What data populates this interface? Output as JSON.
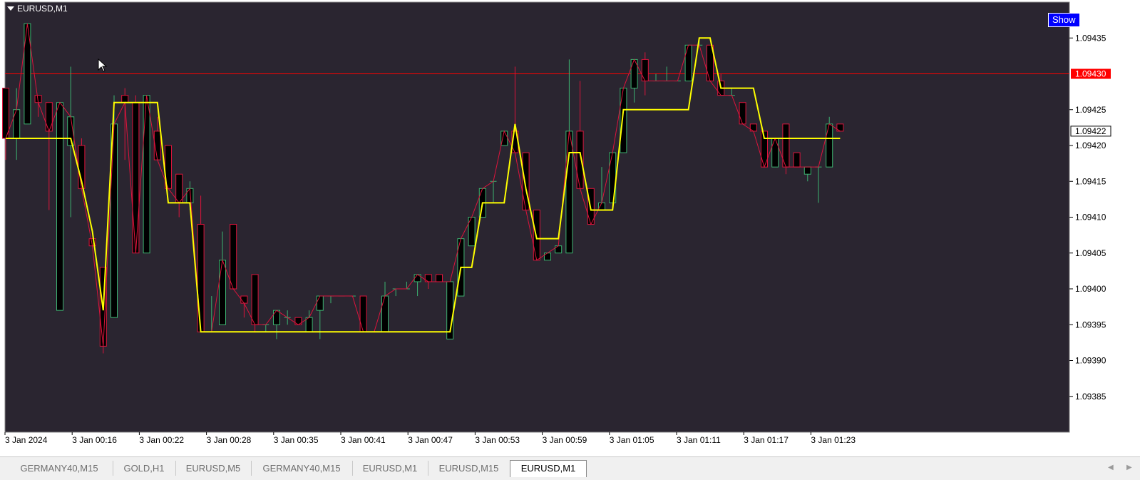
{
  "chart": {
    "symbol": "EURUSD,M1",
    "show_button": "Show",
    "current_price": "1.09422",
    "line_price": "1.09430",
    "price_ticks": [
      "1.09435",
      "1.09425",
      "1.09420",
      "1.09415",
      "1.09410",
      "1.09405",
      "1.09400",
      "1.09395",
      "1.09390",
      "1.09385"
    ],
    "time_ticks": [
      "3 Jan 2024",
      "3 Jan 00:16",
      "3 Jan 00:22",
      "3 Jan 00:28",
      "3 Jan 00:35",
      "3 Jan 00:41",
      "3 Jan 00:47",
      "3 Jan 00:53",
      "3 Jan 00:59",
      "3 Jan 01:05",
      "3 Jan 01:11",
      "3 Jan 01:17",
      "3 Jan 01:23"
    ],
    "colors": {
      "background": "#2a2530",
      "bull": "#3cb371",
      "bear": "#dc143c",
      "yellow": "#ffff00",
      "price_line": "#ff0000",
      "axis_text": "#ffffff"
    },
    "candles": [
      [
        1.09428,
        1.09428,
        1.09418,
        1.09421
      ],
      [
        1.09421,
        1.09428,
        1.09418,
        1.09425
      ],
      [
        1.09423,
        1.09437,
        1.09423,
        1.09437
      ],
      [
        1.09427,
        1.09427,
        1.09424,
        1.09426
      ],
      [
        1.09426,
        1.09426,
        1.09411,
        1.09422
      ],
      [
        1.09397,
        1.09426,
        1.09397,
        1.09426
      ],
      [
        1.0942,
        1.09431,
        1.0941,
        1.09424
      ],
      [
        1.0942,
        1.09421,
        1.09414,
        1.09414
      ],
      [
        1.09407,
        1.09407,
        1.09406,
        1.09406
      ],
      [
        1.09403,
        1.09403,
        1.09391,
        1.09392
      ],
      [
        1.09396,
        1.09427,
        1.09396,
        1.09423
      ],
      [
        1.09427,
        1.09428,
        1.09418,
        1.09426
      ],
      [
        1.09426,
        1.09427,
        1.09405,
        1.09405
      ],
      [
        1.09405,
        1.09427,
        1.09405,
        1.09427
      ],
      [
        1.09422,
        1.09424,
        1.09418,
        1.09418
      ],
      [
        1.0942,
        1.0942,
        1.09414,
        1.09414
      ],
      [
        1.09416,
        1.09416,
        1.0941,
        1.09412
      ],
      [
        1.09412,
        1.09415,
        1.09411,
        1.09414
      ],
      [
        1.09409,
        1.09413,
        1.09394,
        1.09394
      ],
      [
        1.09394,
        1.09399,
        1.09394,
        1.09394
      ],
      [
        1.09395,
        1.09408,
        1.09395,
        1.09404
      ],
      [
        1.09409,
        1.09409,
        1.094,
        1.094
      ],
      [
        1.09399,
        1.09399,
        1.09396,
        1.09398
      ],
      [
        1.09402,
        1.09402,
        1.09394,
        1.09395
      ],
      [
        1.09395,
        1.09395,
        1.09394,
        1.09395
      ],
      [
        1.09395,
        1.09397,
        1.09393,
        1.09397
      ],
      [
        1.09396,
        1.09397,
        1.09395,
        1.09396
      ],
      [
        1.09396,
        1.09396,
        1.09395,
        1.09395
      ],
      [
        1.09394,
        1.09397,
        1.09394,
        1.09396
      ],
      [
        1.09397,
        1.09399,
        1.09393,
        1.09399
      ],
      [
        1.09399,
        1.09399,
        1.09398,
        1.09399
      ],
      [
        1.09399,
        1.09399,
        1.09399,
        1.09399
      ],
      [
        1.09399,
        1.09399,
        1.09399,
        1.09399
      ],
      [
        1.09399,
        1.09399,
        1.09394,
        1.09394
      ],
      [
        1.09394,
        1.09394,
        1.09394,
        1.09394
      ],
      [
        1.09394,
        1.09401,
        1.09394,
        1.09399
      ],
      [
        1.094,
        1.094,
        1.09399,
        1.094
      ],
      [
        1.094,
        1.09401,
        1.094,
        1.094
      ],
      [
        1.09401,
        1.09402,
        1.09399,
        1.09402
      ],
      [
        1.09402,
        1.09402,
        1.094,
        1.09401
      ],
      [
        1.09402,
        1.09402,
        1.09401,
        1.09401
      ],
      [
        1.09393,
        1.09401,
        1.09393,
        1.09401
      ],
      [
        1.09399,
        1.09407,
        1.09399,
        1.09407
      ],
      [
        1.09406,
        1.0941,
        1.09406,
        1.0941
      ],
      [
        1.0941,
        1.09414,
        1.0941,
        1.09414
      ],
      [
        1.09415,
        1.09415,
        1.09412,
        1.09415
      ],
      [
        1.0942,
        1.09422,
        1.0942,
        1.09422
      ],
      [
        1.09422,
        1.09431,
        1.09419,
        1.09419
      ],
      [
        1.09419,
        1.09419,
        1.09411,
        1.09411
      ],
      [
        1.09411,
        1.09411,
        1.09404,
        1.09404
      ],
      [
        1.09404,
        1.09405,
        1.09404,
        1.09405
      ],
      [
        1.09405,
        1.09406,
        1.09405,
        1.09406
      ],
      [
        1.09405,
        1.09432,
        1.09405,
        1.09422
      ],
      [
        1.09422,
        1.09429,
        1.09414,
        1.09414
      ],
      [
        1.09414,
        1.09414,
        1.09409,
        1.09409
      ],
      [
        1.09411,
        1.09417,
        1.09411,
        1.09412
      ],
      [
        1.09412,
        1.09419,
        1.09412,
        1.09419
      ],
      [
        1.09419,
        1.09428,
        1.09419,
        1.09428
      ],
      [
        1.09428,
        1.09432,
        1.09426,
        1.09432
      ],
      [
        1.09432,
        1.09433,
        1.09427,
        1.09429
      ],
      [
        1.09429,
        1.0943,
        1.09429,
        1.09429
      ],
      [
        1.09429,
        1.09431,
        1.09429,
        1.09429
      ],
      [
        1.09429,
        1.09429,
        1.09429,
        1.09429
      ],
      [
        1.09429,
        1.09434,
        1.09429,
        1.09434
      ],
      [
        1.09434,
        1.09435,
        1.09434,
        1.09434
      ],
      [
        1.09434,
        1.09434,
        1.09429,
        1.09429
      ],
      [
        1.09429,
        1.0943,
        1.09427,
        1.09427
      ],
      [
        1.09427,
        1.09428,
        1.09427,
        1.09427
      ],
      [
        1.09426,
        1.09426,
        1.09423,
        1.09423
      ],
      [
        1.09423,
        1.09423,
        1.09422,
        1.09422
      ],
      [
        1.09422,
        1.09422,
        1.09417,
        1.09417
      ],
      [
        1.09417,
        1.09421,
        1.09417,
        1.09421
      ],
      [
        1.09423,
        1.09423,
        1.09416,
        1.09417
      ],
      [
        1.09419,
        1.09419,
        1.09417,
        1.09417
      ],
      [
        1.09416,
        1.09417,
        1.09415,
        1.09417
      ],
      [
        1.09417,
        1.09417,
        1.09412,
        1.09417
      ],
      [
        1.09417,
        1.09424,
        1.09417,
        1.09423
      ],
      [
        1.09423,
        1.09423,
        1.09422,
        1.09422
      ]
    ],
    "yellow_line": [
      1.09421,
      1.09421,
      1.09421,
      1.09421,
      1.09421,
      1.09421,
      1.09421,
      1.09415,
      1.09408,
      1.09397,
      1.09426,
      1.09426,
      1.09426,
      1.09426,
      1.09426,
      1.09412,
      1.09412,
      1.09412,
      1.09394,
      1.09394,
      1.09394,
      1.09394,
      1.09394,
      1.09394,
      1.09394,
      1.09394,
      1.09394,
      1.09394,
      1.09394,
      1.09394,
      1.09394,
      1.09394,
      1.09394,
      1.09394,
      1.09394,
      1.09394,
      1.09394,
      1.09394,
      1.09394,
      1.09394,
      1.09394,
      1.09394,
      1.09403,
      1.09403,
      1.09412,
      1.09412,
      1.09412,
      1.09423,
      1.09414,
      1.09407,
      1.09407,
      1.09407,
      1.09419,
      1.09419,
      1.09411,
      1.09411,
      1.09411,
      1.09425,
      1.09425,
      1.09425,
      1.09425,
      1.09425,
      1.09425,
      1.09425,
      1.09435,
      1.09435,
      1.09428,
      1.09428,
      1.09428,
      1.09428,
      1.09421,
      1.09421,
      1.09421,
      1.09421,
      1.09421,
      1.09421,
      1.09421,
      1.09421
    ]
  },
  "tabs": [
    "GERMANY40,M15",
    "GOLD,H1",
    "EURUSD,M5",
    "GERMANY40,M15",
    "EURUSD,M1",
    "EURUSD,M15",
    "EURUSD,M1"
  ],
  "active_tab": 6
}
